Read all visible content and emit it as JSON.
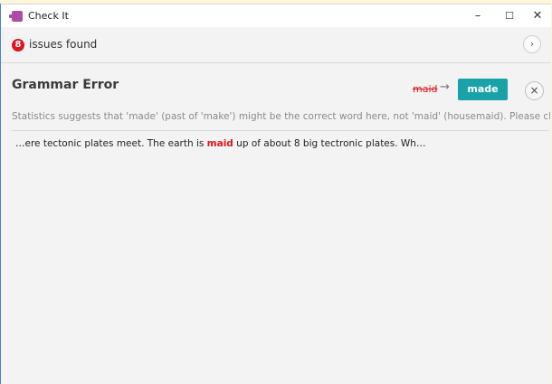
{
  "app": {
    "title": "Check It"
  },
  "window_controls": {
    "minimize": "–",
    "maximize": "☐",
    "close": "✕"
  },
  "issues": {
    "count": "8",
    "label": "issues found",
    "next": "›"
  },
  "error": {
    "title": "Grammar Error",
    "wrong_word": "maid",
    "arrow": "→",
    "suggestion": "made",
    "dismiss": "×",
    "explanation": "Statistics suggests that 'made' (past of 'make') might be the correct word here, not 'maid' (housemaid). Please chec",
    "context_before": "…ere tectonic plates meet.  The earth is ",
    "context_highlight": "maid",
    "context_after": " up of about 8 big tectronic plates.  Wh…"
  }
}
